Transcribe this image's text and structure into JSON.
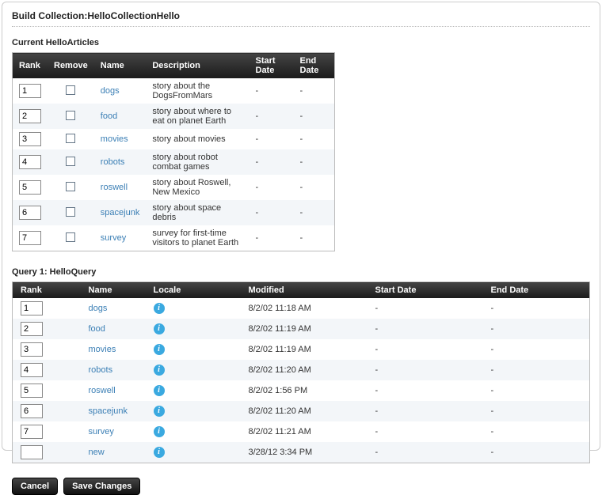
{
  "page": {
    "title": "Build Collection:HelloCollectionHello"
  },
  "section1": {
    "title": "Current HelloArticles",
    "headers": {
      "rank": "Rank",
      "remove": "Remove",
      "name": "Name",
      "description": "Description",
      "start": "Start Date",
      "end": "End Date"
    },
    "rows": [
      {
        "rank": "1",
        "name": "dogs",
        "desc": "story about the DogsFromMars",
        "start": "-",
        "end": "-"
      },
      {
        "rank": "2",
        "name": "food",
        "desc": "story about where to eat on planet Earth",
        "start": "-",
        "end": "-"
      },
      {
        "rank": "3",
        "name": "movies",
        "desc": "story about movies",
        "start": "-",
        "end": "-"
      },
      {
        "rank": "4",
        "name": "robots",
        "desc": "story about robot combat games",
        "start": "-",
        "end": "-"
      },
      {
        "rank": "5",
        "name": "roswell",
        "desc": "story about Roswell, New Mexico",
        "start": "-",
        "end": "-"
      },
      {
        "rank": "6",
        "name": "spacejunk",
        "desc": "story about space debris",
        "start": "-",
        "end": "-"
      },
      {
        "rank": "7",
        "name": "survey",
        "desc": "survey for first-time visitors to planet Earth",
        "start": "-",
        "end": "-"
      }
    ]
  },
  "section2": {
    "title": "Query 1: HelloQuery",
    "headers": {
      "rank": "Rank",
      "name": "Name",
      "locale": "Locale",
      "modified": "Modified",
      "start": "Start Date",
      "end": "End Date"
    },
    "rows": [
      {
        "rank": "1",
        "name": "dogs",
        "modified": "8/2/02 11:18 AM",
        "start": "-",
        "end": "-"
      },
      {
        "rank": "2",
        "name": "food",
        "modified": "8/2/02 11:19 AM",
        "start": "-",
        "end": "-"
      },
      {
        "rank": "3",
        "name": "movies",
        "modified": "8/2/02 11:19 AM",
        "start": "-",
        "end": "-"
      },
      {
        "rank": "4",
        "name": "robots",
        "modified": "8/2/02 11:20 AM",
        "start": "-",
        "end": "-"
      },
      {
        "rank": "5",
        "name": "roswell",
        "modified": "8/2/02 1:56 PM",
        "start": "-",
        "end": "-"
      },
      {
        "rank": "6",
        "name": "spacejunk",
        "modified": "8/2/02 11:20 AM",
        "start": "-",
        "end": "-"
      },
      {
        "rank": "7",
        "name": "survey",
        "modified": "8/2/02 11:21 AM",
        "start": "-",
        "end": "-"
      },
      {
        "rank": "",
        "name": "new",
        "modified": "3/28/12 3:34 PM",
        "start": "-",
        "end": "-"
      }
    ]
  },
  "buttons": {
    "cancel": "Cancel",
    "save": "Save Changes"
  },
  "icons": {
    "info": "i"
  }
}
